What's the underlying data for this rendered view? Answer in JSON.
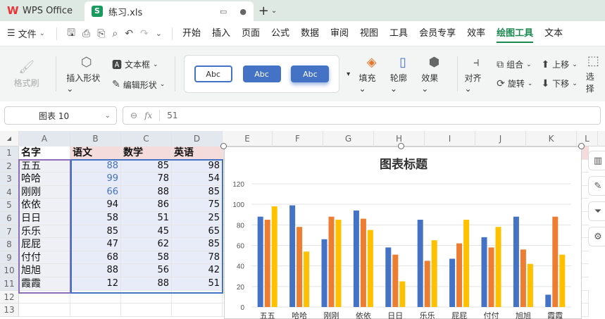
{
  "app": {
    "name": "WPS Office",
    "doc_tab": "练习.xls"
  },
  "menubar": {
    "file": "文件",
    "items": [
      "开始",
      "插入",
      "页面",
      "公式",
      "数据",
      "审阅",
      "视图",
      "工具",
      "会员专享",
      "效率",
      "绘图工具",
      "文本"
    ],
    "active": "绘图工具"
  },
  "ribbon": {
    "format_painter": "格式刷",
    "insert_shape": "插入形状",
    "textbox": "文本框",
    "edit_shape": "编辑形状",
    "style_samples": [
      "Abc",
      "Abc",
      "Abc"
    ],
    "fill": "填充",
    "outline": "轮廓",
    "effects": "效果",
    "align": "对齐",
    "group": "组合",
    "rotate": "旋转",
    "bring_forward": "上移",
    "send_backward": "下移",
    "select": "选择"
  },
  "formula_bar": {
    "name_box": "图表 10",
    "fx": "fx",
    "value": "51"
  },
  "columns": [
    "A",
    "B",
    "C",
    "D",
    "E",
    "F",
    "G",
    "H",
    "I",
    "J",
    "K",
    "L"
  ],
  "rows": [
    "1",
    "2",
    "3",
    "4",
    "5",
    "6",
    "7",
    "8",
    "9",
    "10",
    "11",
    "12",
    "13"
  ],
  "table": {
    "headers": [
      "名字",
      "语文",
      "数学",
      "英语"
    ],
    "data": [
      [
        "五五",
        "88",
        "85",
        "98"
      ],
      [
        "哈哈",
        "99",
        "78",
        "54"
      ],
      [
        "刚刚",
        "66",
        "88",
        "85"
      ],
      [
        "依依",
        "94",
        "86",
        "75"
      ],
      [
        "日日",
        "58",
        "51",
        "25"
      ],
      [
        "乐乐",
        "85",
        "45",
        "65"
      ],
      [
        "屁屁",
        "47",
        "62",
        "85"
      ],
      [
        "付付",
        "68",
        "58",
        "78"
      ],
      [
        "旭旭",
        "88",
        "56",
        "42"
      ],
      [
        "霞霞",
        "12",
        "88",
        "51"
      ]
    ]
  },
  "chart_data": {
    "type": "bar",
    "title": "图表标题",
    "categories": [
      "五五",
      "哈哈",
      "刚刚",
      "依依",
      "日日",
      "乐乐",
      "屁屁",
      "付付",
      "旭旭",
      "霞霞"
    ],
    "series": [
      {
        "values": [
          88,
          99,
          66,
          94,
          58,
          85,
          47,
          68,
          88,
          12
        ],
        "color": "#4472c4"
      },
      {
        "values": [
          85,
          78,
          88,
          86,
          51,
          45,
          62,
          58,
          56,
          88
        ],
        "color": "#ed7d31"
      },
      {
        "values": [
          98,
          54,
          85,
          75,
          25,
          65,
          85,
          78,
          42,
          51
        ],
        "color": "#ffc000"
      }
    ],
    "yticks": [
      "0",
      "20",
      "40",
      "60",
      "80",
      "100",
      "120"
    ],
    "ylim": [
      0,
      120
    ],
    "grid": true
  }
}
